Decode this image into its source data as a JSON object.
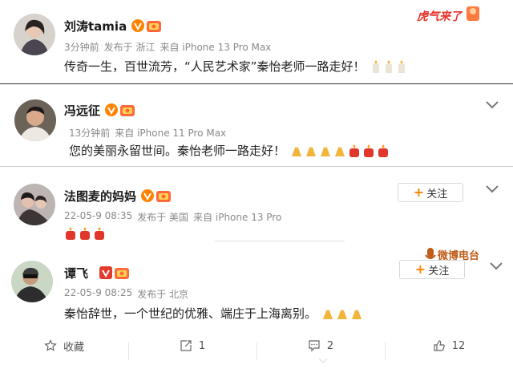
{
  "posts": [
    {
      "name": "刘涛tamia",
      "meta": [
        "3分钟前",
        "发布于 浙江",
        "来自 iPhone 13 Pro Max"
      ],
      "text": "传奇一生，百世流芳，“人民艺术家”秦怡老师一路走好！",
      "emoji": "candle-icon x3",
      "sticker": "虎气来了",
      "colors": {
        "avatar_bg": "#c9c3bf"
      }
    },
    {
      "name": "冯远征",
      "meta": [
        "13分钟前",
        "来自 iPhone 11 Pro Max"
      ],
      "text": "您的美丽永留世间。秦怡老师一路走好！",
      "emoji": "pray-icon x4, red-candle-icon x3"
    },
    {
      "name": "法图麦的妈妈",
      "meta": [
        "22-05-9 08:35",
        "发布于 美国",
        "来自 iPhone 13 Pro"
      ],
      "text": "",
      "follow_label": "关注",
      "emoji": "red-candle-icon x3"
    },
    {
      "name": "谭飞",
      "meta": [
        "22-05-9 08:25",
        "发布于 北京"
      ],
      "text": "秦怡辞世，一个世纪的优雅、端庄于上海离别。",
      "follow_label": "关注",
      "emoji": "pray-icon x3",
      "badge": "微博电台"
    }
  ],
  "footer": {
    "favorite_label": "收藏",
    "repost_count": "1",
    "comment_count": "2",
    "like_count": "12"
  },
  "colors": {
    "accent": "#ff8200",
    "vip": "#ff8200",
    "meta": "#8a8a8a"
  }
}
